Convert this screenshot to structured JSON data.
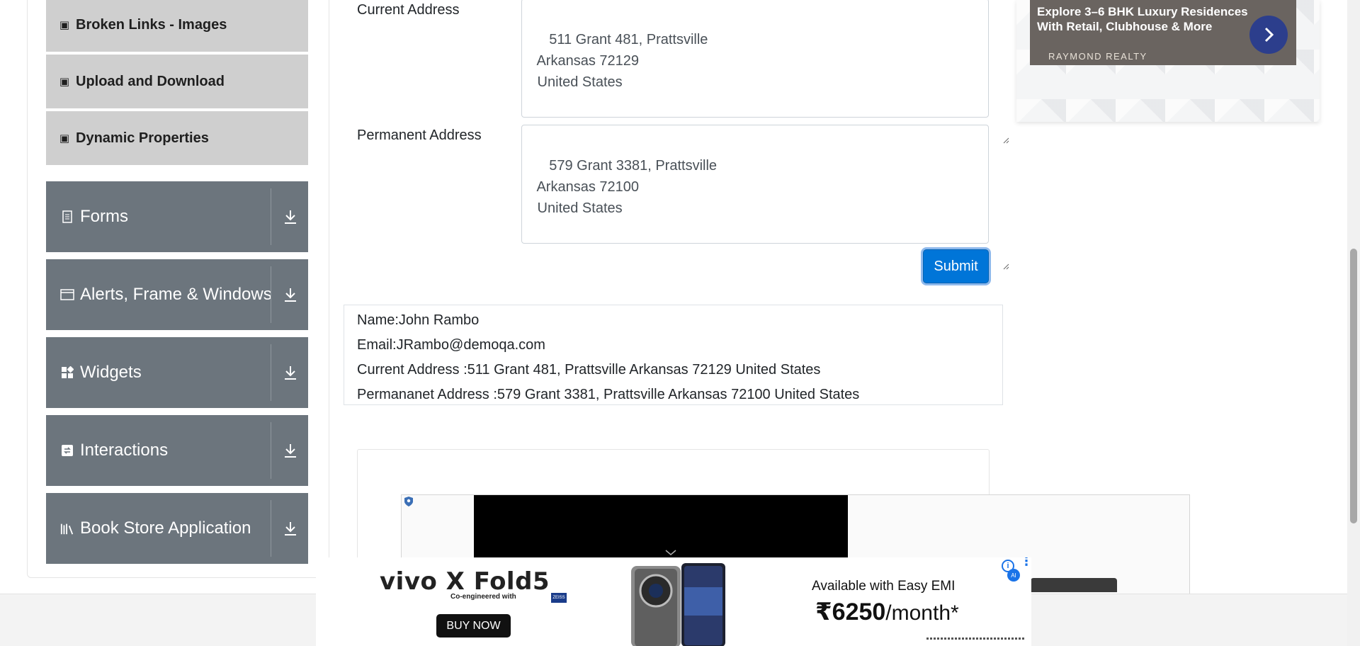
{
  "sidebar": {
    "sub_items": [
      {
        "label": "Broken Links - Images",
        "icon": "html5-icon"
      },
      {
        "label": "Upload and Download",
        "icon": "html5-icon"
      },
      {
        "label": "Dynamic Properties",
        "icon": "html5-icon"
      }
    ],
    "groups": [
      {
        "label": "Forms",
        "icon": "document-icon"
      },
      {
        "label": "Alerts, Frame & Windows",
        "icon": "window-icon"
      },
      {
        "label": "Widgets",
        "icon": "widgets-icon"
      },
      {
        "label": "Interactions",
        "icon": "interactions-icon"
      },
      {
        "label": "Book Store Application",
        "icon": "books-icon"
      }
    ]
  },
  "form": {
    "current_address_label": "Current Address",
    "current_address_value": "511 Grant 481, Prattsville\n Arkansas 72129\n United States",
    "permanent_address_label": "Permanent Address",
    "permanent_address_value": "579 Grant 3381, Prattsville\n Arkansas 72100\n United States",
    "submit_label": "Submit"
  },
  "output": {
    "name": "Name:John Rambo",
    "email": "Email:JRambo@demoqa.com",
    "current_address": "Current Address :511 Grant 481, Prattsville Arkansas 72129 United States",
    "permanent_address": "Permananet Address :579 Grant 3381, Prattsville Arkansas 72100 United States"
  },
  "ad_right": {
    "headline": "Explore 3–6 BHK Luxury Residences With Retail, Clubhouse & More",
    "brand": "RAYMOND REALTY"
  },
  "ad_bottom": {
    "brand": "vivo X Fold5",
    "co_engineered": "Co-engineered with",
    "zeiss": "ZEISS",
    "cta": "BUY NOW",
    "emi_text": "Available with Easy EMI",
    "price": "₹6250",
    "per_month": "/month*"
  },
  "colors": {
    "accent": "#0075d8",
    "sidebar_group": "#6c757d",
    "sidebar_sub": "#cfcfcf"
  }
}
